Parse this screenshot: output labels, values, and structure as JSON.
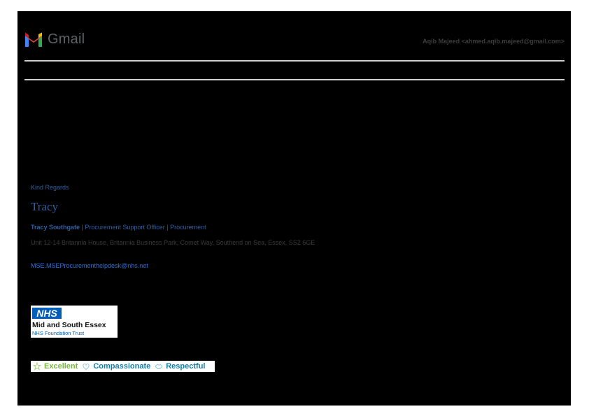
{
  "header": {
    "brand": "Gmail",
    "account": "Aqib Majeed <ahmed.aqib.majeed@gmail.com>",
    "logo_icon": "gmail-m-icon"
  },
  "signature": {
    "closing": "Kind Regards",
    "signoff": "Tracy",
    "name": "Tracy Southgate",
    "role_line": " | Procurement Support Officer | Procurement",
    "address": "Unit 12-14 Britannia House, Britannia Business Park, Comet Way, Southend on Sea, Essex, SS2 6GE",
    "email": "MSE.MSEProcurementhelpdesk@nhs.net"
  },
  "nhs_logo": {
    "badge": "NHS",
    "org": "Mid and South Essex",
    "trust": "NHS Foundation Trust"
  },
  "values": [
    {
      "label": "Excellent",
      "icon": "star-icon"
    },
    {
      "label": "Compassionate",
      "icon": "heart-icon"
    },
    {
      "label": "Respectful",
      "icon": "handshake-icon"
    }
  ],
  "colors": {
    "nhs_blue": "#005eb8",
    "link_blue": "#2f5fa0",
    "excellent_green": "#78b83c"
  }
}
